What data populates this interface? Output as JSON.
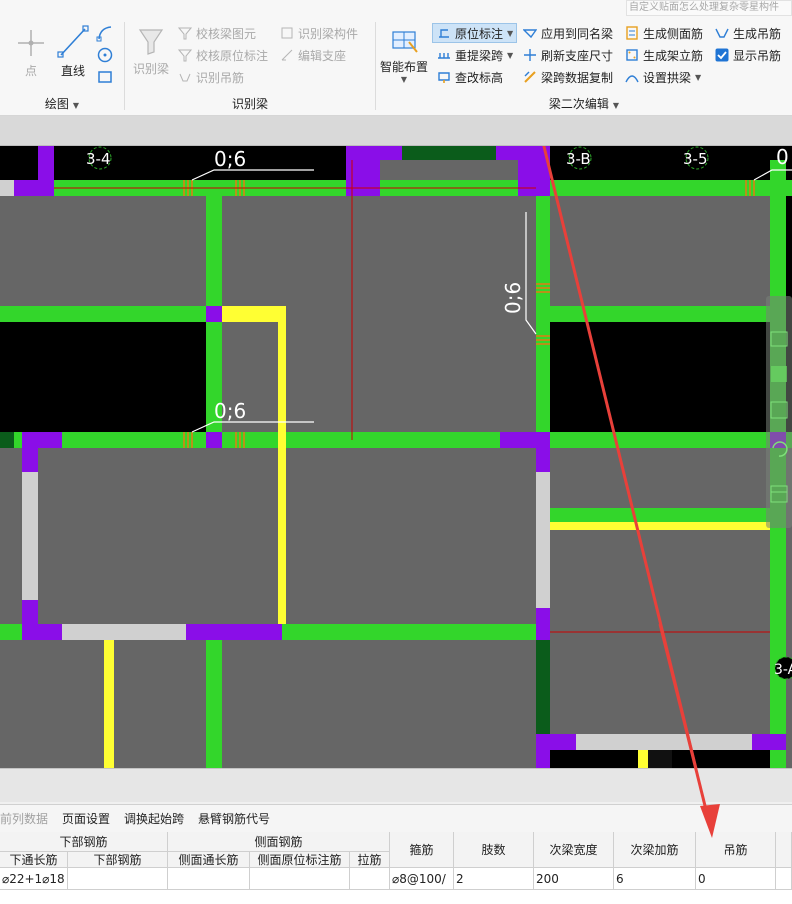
{
  "search_hint": "自定义贴面怎么处理复杂零星构件",
  "ribbon": {
    "draw_group": {
      "title": "绘图",
      "point_label": "点",
      "line_label": "直线"
    },
    "recognize_group": {
      "title": "识别梁",
      "recognize_beam_label": "识别梁",
      "check_beam_label": "校核梁图元",
      "check_annotation_label": "校核原位标注",
      "recognize_hanger_label": "识别吊筋",
      "recognize_component_label": "识别梁构件",
      "edit_support_label": "编辑支座"
    },
    "edit_group": {
      "title": "梁二次编辑",
      "smart_layout_label": "智能布置",
      "in_situ_label": "原位标注",
      "relift_span_label": "重提梁跨",
      "change_elevation_label": "查改标高",
      "apply_same_name_label": "应用到同名梁",
      "refresh_support_label": "刷新支座尺寸",
      "copy_span_data_label": "梁跨数据复制",
      "gen_side_bar_label": "生成侧面筋",
      "gen_stirrup_label": "生成架立筋",
      "set_arch_label": "设置拱梁",
      "gen_hanger_label": "生成吊筋",
      "show_hanger_label": "显示吊筋"
    }
  },
  "canvas": {
    "axis_labels": [
      "3-4",
      "3-B",
      "3-5"
    ],
    "axis_label_right": "3-A",
    "dim_label_a": "0;6",
    "dim_label_b": "0;6",
    "dim_label_c": "0;6",
    "dim_label_d": "0",
    "colors": {
      "beam_green": "#33d62b",
      "column_purple": "#8a0ee8",
      "yellow": "#ffff33",
      "slab_gray": "#666666",
      "white_beam": "#d0d0d0",
      "dark_green": "#0b5c1b",
      "red_line": "#cc0000",
      "arrow_red": "#e8403a"
    }
  },
  "tabs": [
    "前列数据",
    "页面设置",
    "调换起始跨",
    "悬臂钢筋代号"
  ],
  "table": {
    "group_headers": {
      "bottom": "下部钢筋",
      "side": "侧面钢筋"
    },
    "headers": {
      "bottom_through": "下通长筋",
      "bottom_bar": "下部钢筋",
      "side_through": "侧面通长筋",
      "side_in_situ": "侧面原位标注筋",
      "tie": "拉筋",
      "stirrup": "箍筋",
      "legs": "肢数",
      "secondary_width": "次梁宽度",
      "secondary_extra": "次梁加筋",
      "hanger": "吊筋"
    },
    "row": {
      "bottom_through": "⌀22+1⌀18",
      "bottom_bar": "",
      "side_through": "",
      "side_in_situ": "",
      "tie": "",
      "stirrup": "⌀8@100/",
      "legs": "2",
      "secondary_width": "200",
      "secondary_extra": "6",
      "hanger": "0"
    }
  }
}
